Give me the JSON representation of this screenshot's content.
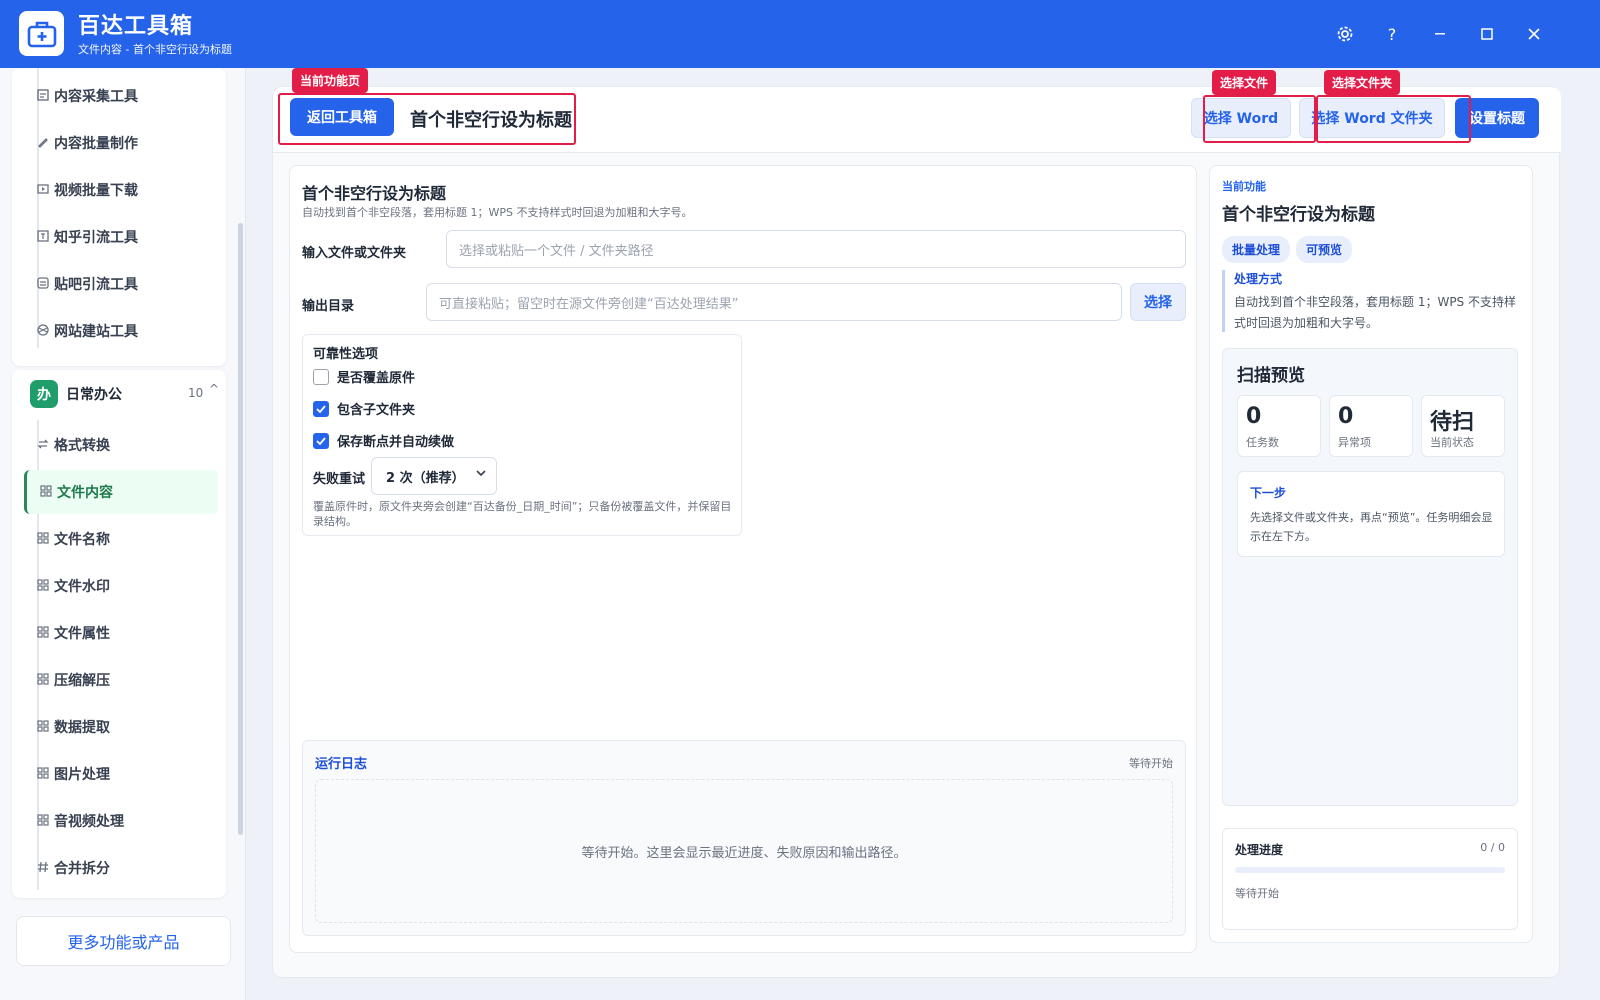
{
  "app": {
    "title": "百达工具箱",
    "subtitle": "文件内容 - 首个非空行设为标题"
  },
  "sidebar": {
    "top_items": [
      {
        "label": "内容采集工具",
        "icon": "document-icon"
      },
      {
        "label": "内容批量制作",
        "icon": "pencil-icon"
      },
      {
        "label": "视频批量下载",
        "icon": "video-icon"
      },
      {
        "label": "知乎引流工具",
        "icon": "zhihu-icon"
      },
      {
        "label": "贴吧引流工具",
        "icon": "tieba-icon"
      },
      {
        "label": "网站建站工具",
        "icon": "globe-icon"
      }
    ],
    "group": {
      "badge": "办",
      "name": "日常办公",
      "count": "10",
      "chevron": "^"
    },
    "group_items": [
      {
        "label": "格式转换",
        "icon": "swap-icon"
      },
      {
        "label": "文件内容",
        "icon": "grid-icon",
        "active": true
      },
      {
        "label": "文件名称",
        "icon": "grid-icon"
      },
      {
        "label": "文件水印",
        "icon": "grid-icon"
      },
      {
        "label": "文件属性",
        "icon": "grid-icon"
      },
      {
        "label": "压缩解压",
        "icon": "grid-icon"
      },
      {
        "label": "数据提取",
        "icon": "grid-icon"
      },
      {
        "label": "图片处理",
        "icon": "grid-icon"
      },
      {
        "label": "音视频处理",
        "icon": "grid-icon"
      },
      {
        "label": "合并拆分",
        "icon": "hash-icon"
      }
    ],
    "more_label": "更多功能或产品"
  },
  "header": {
    "tag_current": "当前功能页",
    "back_label": "返回工具箱",
    "title": "首个非空行设为标题",
    "tag_file": "选择文件",
    "tag_folder": "选择文件夹",
    "select_word": "选择 Word",
    "select_word_folder": "选择 Word 文件夹",
    "set_title": "设置标题"
  },
  "form": {
    "title": "首个非空行设为标题",
    "desc": "自动找到首个非空段落，套用标题 1；WPS 不支持样式时回退为加粗和大字号。",
    "input_label": "输入文件或文件夹",
    "input_placeholder": "选择或粘贴一个文件 / 文件夹路径",
    "output_label": "输出目录",
    "output_placeholder": "可直接粘贴；留空时在源文件旁创建“百达处理结果”",
    "choose_label": "选择",
    "options": {
      "title": "可靠性选项",
      "overwrite": "是否覆盖原件",
      "overwrite_checked": false,
      "subfolders": "包含子文件夹",
      "subfolders_checked": true,
      "resume": "保存断点并自动续做",
      "resume_checked": true,
      "retry_label": "失败重试",
      "retry_value": "2 次（推荐）",
      "note": "覆盖原件时，原文件夹旁会创建“百达备份_日期_时间”；只备份被覆盖文件，并保留目录结构。"
    }
  },
  "log": {
    "title": "运行日志",
    "status": "等待开始",
    "empty": "等待开始。这里会显示最近进度、失败原因和输出路径。"
  },
  "right": {
    "small_label": "当前功能",
    "title": "首个非空行设为标题",
    "chips": [
      "批量处理",
      "可预览"
    ],
    "method_title": "处理方式",
    "method_desc": "自动找到首个非空段落，套用标题 1；WPS 不支持样式时回退为加粗和大字号。",
    "scan": {
      "title": "扫描预览",
      "stats": [
        {
          "value": "0",
          "label": "任务数"
        },
        {
          "value": "0",
          "label": "异常项"
        },
        {
          "value": "待扫",
          "label": "当前状态"
        }
      ],
      "next_title": "下一步",
      "next_desc": "先选择文件或文件夹，再点“预览”。任务明细会显示在左下方。"
    },
    "progress": {
      "title": "处理进度",
      "count": "0 / 0",
      "status": "等待开始",
      "fraction": 0
    }
  },
  "colors": {
    "primary": "#2563eb",
    "danger": "#e11d48",
    "success": "#1f9d6b"
  }
}
